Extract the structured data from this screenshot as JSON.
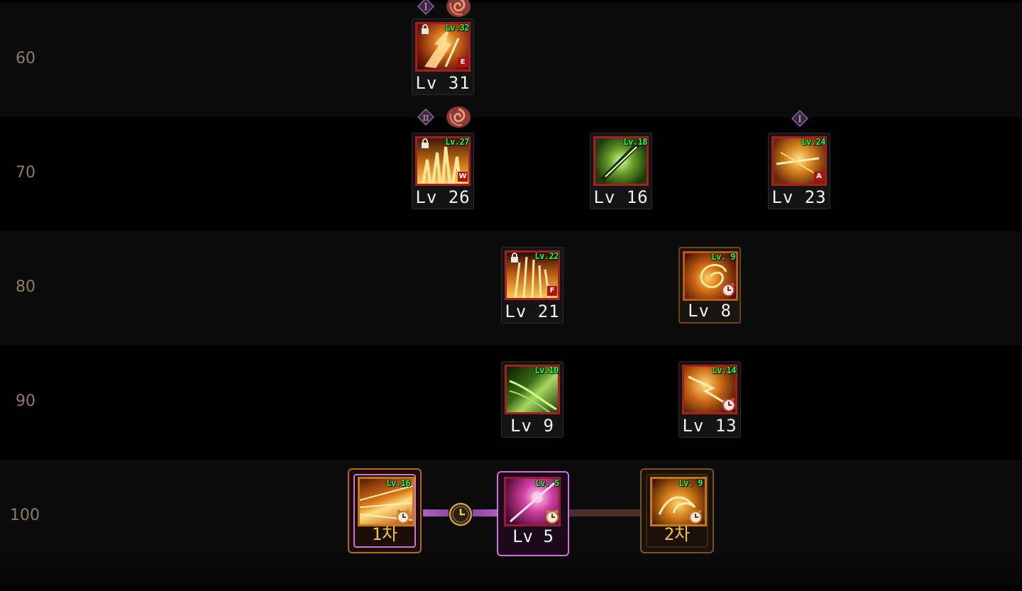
{
  "rows": [
    {
      "label": "60"
    },
    {
      "label": "70"
    },
    {
      "label": "80"
    },
    {
      "label": "90"
    },
    {
      "label": "100"
    }
  ],
  "skills": {
    "r60_a": {
      "badge": "Lv.32",
      "level": "Lv 31",
      "element": "E",
      "rune": "I"
    },
    "r70_a": {
      "badge": "Lv.27",
      "level": "Lv 26",
      "element": "W",
      "rune": "II"
    },
    "r70_b": {
      "badge": "Lv.18",
      "level": "Lv 16"
    },
    "r70_c": {
      "badge": "Lv.24",
      "level": "Lv 23",
      "element": "A",
      "rune": "I"
    },
    "r80_a": {
      "badge": "Lv.22",
      "level": "Lv 21",
      "element": "F"
    },
    "r80_b": {
      "badge": "Lv. 9",
      "level": "Lv 8"
    },
    "r90_a": {
      "badge": "Lv.10",
      "level": "Lv 9"
    },
    "r90_b": {
      "badge": "Lv.14",
      "level": "Lv 13"
    },
    "r100_a": {
      "badge": "Lv.16",
      "level": "1차"
    },
    "r100_b": {
      "badge": "Lv. 5",
      "level": "Lv 5"
    },
    "r100_c": {
      "badge": "Lv. 9",
      "level": "2차"
    }
  },
  "colors": {
    "label": "#8f7d61",
    "level_badge": "#24ff3a",
    "skill_frame_red": "#a91e1e",
    "skill_frame_orange": "#ba5a12",
    "awakening_gold": "#f0c020",
    "awakening_pink": "#e070e0"
  }
}
